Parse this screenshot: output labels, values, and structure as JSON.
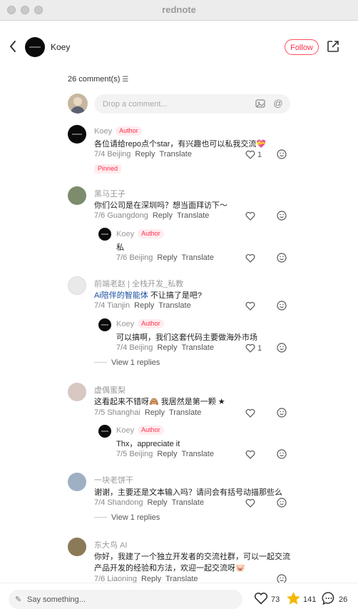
{
  "window": {
    "title": "rednote"
  },
  "author": {
    "name": "Koey",
    "follow_label": "Follow"
  },
  "comments_header": {
    "count_label": "26 comment(s)"
  },
  "comment_input": {
    "placeholder": "Drop a comment..."
  },
  "labels": {
    "reply": "Reply",
    "translate": "Translate",
    "author_badge": "Author",
    "pinned": "Pinned"
  },
  "comments": [
    {
      "user": "Koey",
      "text": "各位请给repo点个star，有兴趣也可以私我交流💝",
      "date": "7/4 Beijing",
      "likes": "1"
    },
    {
      "user": "黑马王子",
      "text": "你们公司是在深圳吗？想当面拜访下～",
      "date": "7/6 Guangdong",
      "reply": {
        "user": "Koey",
        "text": "私",
        "date": "7/6 Beijing"
      }
    },
    {
      "user": "前端老赵 | 全栈开发_私教",
      "text_link": "Ai陪伴的智能体",
      "text_rest": " 不让搞了是吧?",
      "date": "7/4 Tianjin",
      "reply": {
        "user": "Koey",
        "text": "可以搞啊，我们这套代码主要做海外市场",
        "date": "7/4 Beijing",
        "likes": "1"
      },
      "view_replies": "View 1 replies"
    },
    {
      "user": "虚偶蜜梨",
      "text": "这看起来不错呀🙈 我居然是第一颗 ★",
      "date": "7/5 Shanghai",
      "reply": {
        "user": "Koey",
        "text": "Thx，appreciate it",
        "date": "7/5 Beijing"
      }
    },
    {
      "user": "一块老饼干",
      "text": "谢谢，主要还是文本输入吗？请问会有括号动描那些么",
      "date": "7/4 Shandong",
      "view_replies": "View 1 replies"
    },
    {
      "user": "东大鸟 AI",
      "text": "你好，我建了一个独立开发者的交流社群，可以一起交流",
      "text2": "产品开发的经验和方法，欢迎一起交流呀🐷",
      "date": "7/6 Liaoning"
    }
  ],
  "bottom_bar": {
    "placeholder": "Say something...",
    "likes": "73",
    "stars": "141",
    "comments": "26"
  },
  "colors": {
    "accent": "#ff2e4d",
    "badge_bg": "#ffecee",
    "star": "#f5b800"
  },
  "icons": [
    "back-icon",
    "share-icon",
    "image-icon",
    "mention-icon",
    "heart-icon",
    "smiley-icon",
    "pen-icon",
    "star-icon",
    "chat-icon",
    "filter-icon"
  ]
}
